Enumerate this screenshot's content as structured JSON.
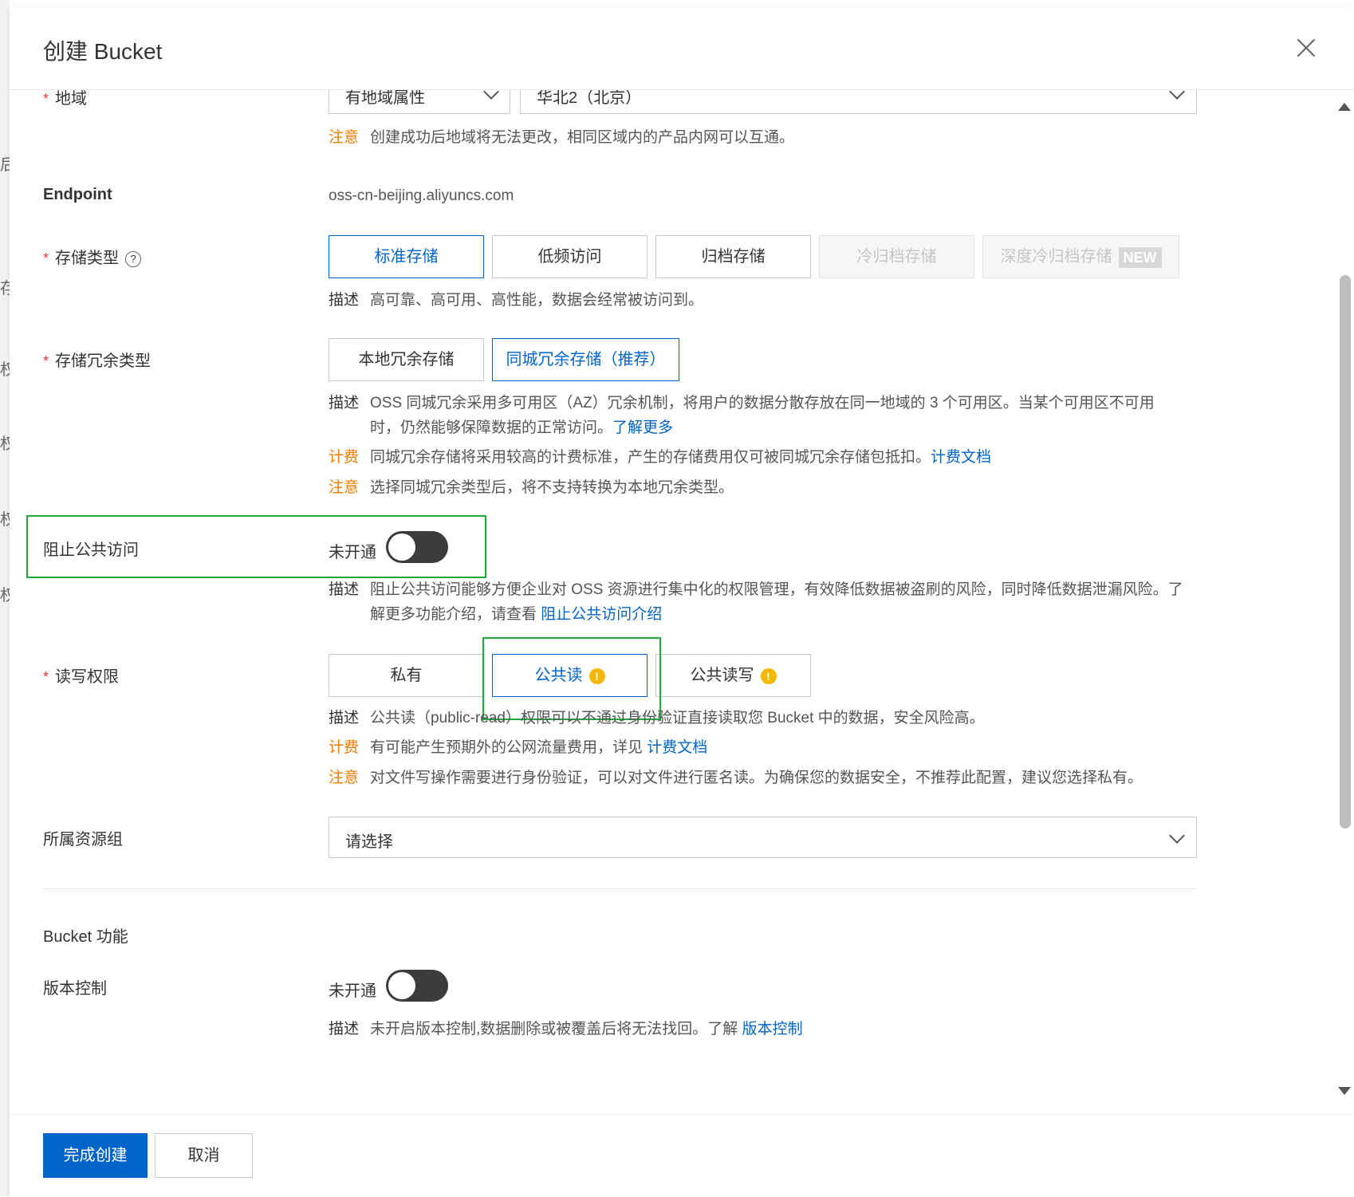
{
  "background": {
    "chars": [
      "后",
      "存",
      "权",
      "权",
      "权",
      "权"
    ]
  },
  "dialog": {
    "title": "创建 Bucket"
  },
  "region": {
    "label": "地域",
    "attr_select": "有地域属性",
    "region_select": "华北2（北京）",
    "note_tag": "注意",
    "note_text": "创建成功后地域将无法更改，相同区域内的产品内网可以互通。"
  },
  "endpoint": {
    "label": "Endpoint",
    "value": "oss-cn-beijing.aliyuncs.com"
  },
  "storage_class": {
    "label": "存储类型",
    "options": [
      "标准存储",
      "低频访问",
      "归档存储",
      "冷归档存储",
      "深度冷归档存储"
    ],
    "new_badge": "NEW",
    "desc_tag": "描述",
    "desc_text": "高可靠、高可用、高性能，数据会经常被访问到。"
  },
  "redundancy": {
    "label": "存储冗余类型",
    "options": [
      "本地冗余存储",
      "同城冗余存储（推荐）"
    ],
    "desc_tag": "描述",
    "desc_text": "OSS 同城冗余采用多可用区（AZ）冗余机制，将用户的数据分散存放在同一地域的 3 个可用区。当某个可用区不可用时，仍然能够保障数据的正常访问。",
    "desc_link": "了解更多",
    "billing_tag": "计费",
    "billing_text": "同城冗余存储将采用较高的计费标准，产生的存储费用仅可被同城冗余存储包抵扣。",
    "billing_link": "计费文档",
    "note_tag": "注意",
    "note_text": "选择同城冗余类型后，将不支持转换为本地冗余类型。"
  },
  "block_public": {
    "label": "阻止公共访问",
    "status": "未开通",
    "desc_tag": "描述",
    "desc_text": "阻止公共访问能够方便企业对 OSS 资源进行集中化的权限管理，有效降低数据被盗刷的风险，同时降低数据泄漏风险。了解更多功能介绍，请查看 ",
    "desc_link": "阻止公共访问介绍"
  },
  "acl": {
    "label": "读写权限",
    "options": [
      "私有",
      "公共读",
      "公共读写"
    ],
    "desc_tag": "描述",
    "desc_text": "公共读（public-read）权限可以不通过身份验证直接读取您 Bucket 中的数据，安全风险高。",
    "billing_tag": "计费",
    "billing_text": "有可能产生预期外的公网流量费用，详见 ",
    "billing_link": "计费文档",
    "note_tag": "注意",
    "note_text": "对文件写操作需要进行身份验证，可以对文件进行匿名读。为确保您的数据安全，不推荐此配置，建议您选择私有。"
  },
  "resource_group": {
    "label": "所属资源组",
    "placeholder": "请选择"
  },
  "bucket_features": {
    "heading": "Bucket 功能"
  },
  "versioning": {
    "label": "版本控制",
    "status": "未开通",
    "desc_tag": "描述",
    "desc_text": "未开启版本控制,数据删除或被覆盖后将无法找回。了解 ",
    "desc_link": "版本控制"
  },
  "footer": {
    "submit": "完成创建",
    "cancel": "取消"
  },
  "colors": {
    "primary": "#0064c8",
    "warning": "#f07c00",
    "highlight": "#22a83a"
  }
}
